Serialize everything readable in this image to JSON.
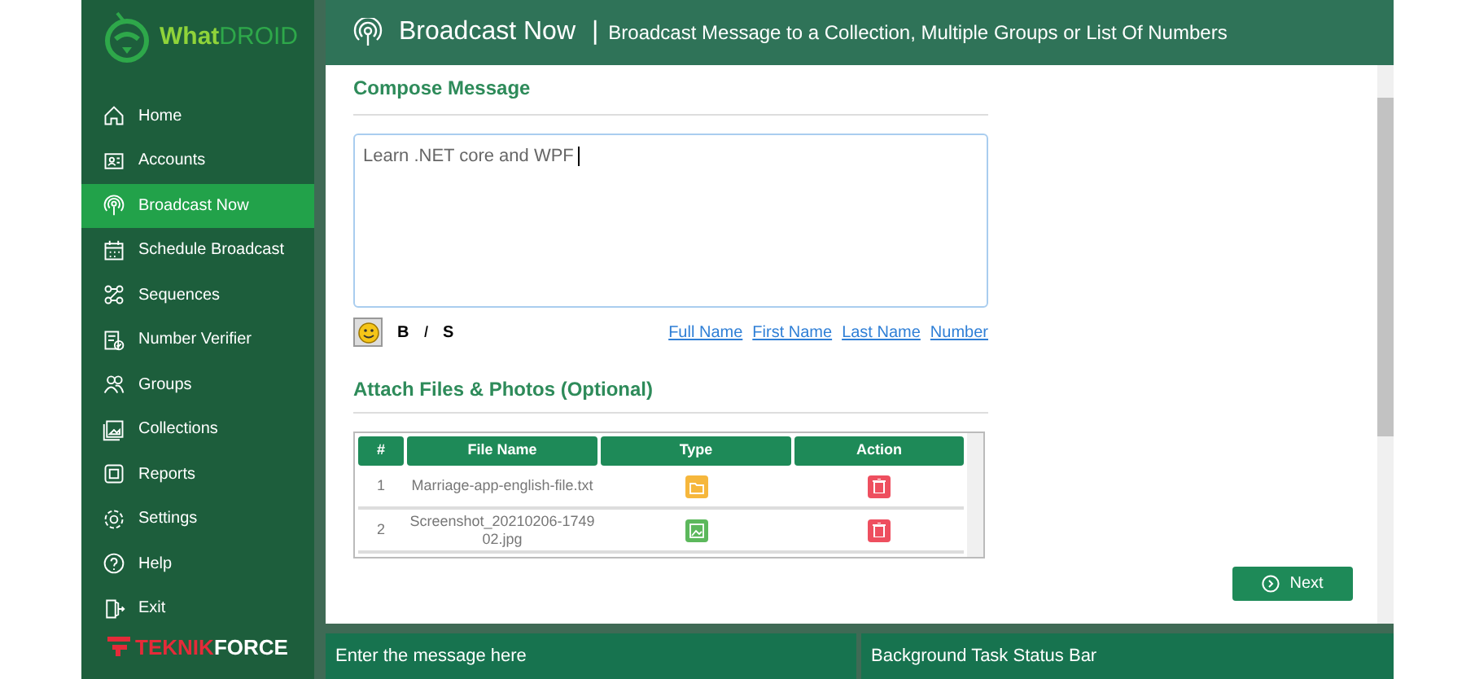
{
  "logo": {
    "part_1": "What",
    "part_2": "DROID"
  },
  "sidebar": {
    "items": [
      {
        "label": "Home",
        "kind": "home",
        "selected": false
      },
      {
        "label": "Accounts",
        "kind": "accounts",
        "selected": false
      },
      {
        "label": "Broadcast Now",
        "kind": "broadcast",
        "selected": true
      },
      {
        "label": "Schedule Broadcast",
        "kind": "calendar",
        "selected": false
      },
      {
        "label": "Sequences",
        "kind": "sequences",
        "selected": false
      },
      {
        "label": "Number Verifier",
        "kind": "verifier",
        "selected": false
      },
      {
        "label": "Groups",
        "kind": "groups",
        "selected": false
      },
      {
        "label": "Collections",
        "kind": "collections",
        "selected": false
      },
      {
        "label": "Reports",
        "kind": "reports",
        "selected": false
      },
      {
        "label": "Settings",
        "kind": "settings",
        "selected": false
      },
      {
        "label": "Help",
        "kind": "help",
        "selected": false
      },
      {
        "label": "Exit",
        "kind": "exit",
        "selected": false
      }
    ]
  },
  "brand": {
    "part_1": "TEKNIK",
    "part_2": "FORCE"
  },
  "header": {
    "title": "Broadcast Now",
    "separator": "|",
    "subtitle": "Broadcast Message to a Collection, Multiple Groups or List Of Numbers"
  },
  "compose": {
    "heading": "Compose Message",
    "value": "Learn .NET core and WPF",
    "format_buttons": [
      "B",
      "I",
      "S"
    ],
    "placeholders": [
      "Full Name",
      "First Name",
      "Last Name",
      "Number"
    ]
  },
  "attach": {
    "heading": "Attach Files & Photos (Optional)",
    "columns": [
      "#",
      "File Name",
      "Type",
      "Action"
    ],
    "rows": [
      {
        "index": "1",
        "file_name": "Marriage-app-english-file.txt",
        "kind": "file"
      },
      {
        "index": "2",
        "file_name": "Screenshot_20210206-174902.jpg",
        "kind": "image"
      }
    ]
  },
  "next_button": "Next",
  "status_bar": {
    "message": "Enter the message here",
    "task_status": "Background Task Status Bar"
  }
}
